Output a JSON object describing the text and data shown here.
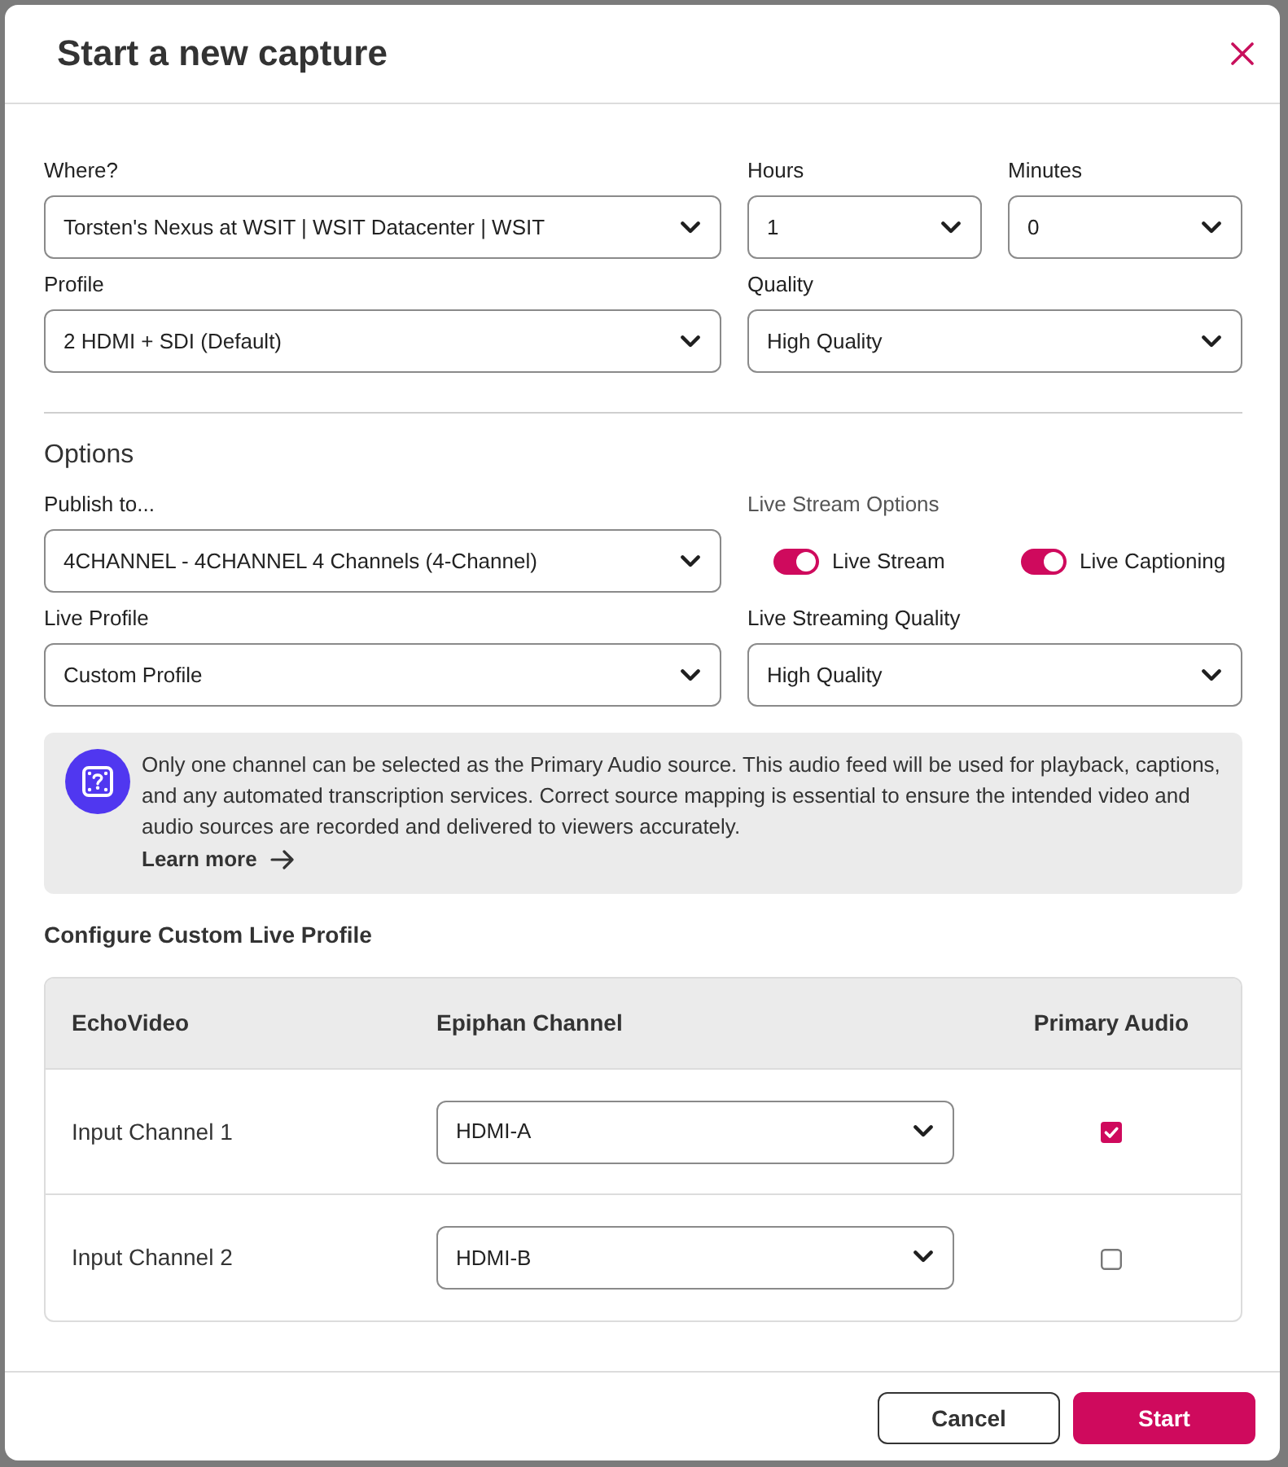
{
  "dialog": {
    "title": "Start a new capture"
  },
  "capture": {
    "where": {
      "label": "Where?",
      "value": "Torsten's Nexus at WSIT | WSIT Datacenter | WSIT"
    },
    "hours": {
      "label": "Hours",
      "value": "1"
    },
    "minutes": {
      "label": "Minutes",
      "value": "0"
    },
    "profile": {
      "label": "Profile",
      "value": "2 HDMI + SDI (Default)"
    },
    "quality": {
      "label": "Quality",
      "value": "High Quality"
    }
  },
  "options": {
    "heading": "Options",
    "publish_to": {
      "label": "Publish to...",
      "value": "4CHANNEL - 4CHANNEL 4 Channels (4-Channel)"
    },
    "live_stream_options": {
      "label": "Live Stream Options",
      "toggles": [
        {
          "label": "Live Stream",
          "on": true
        },
        {
          "label": "Live Captioning",
          "on": true
        }
      ]
    },
    "live_profile": {
      "label": "Live Profile",
      "value": "Custom Profile"
    },
    "live_streaming_quality": {
      "label": "Live Streaming Quality",
      "value": "High Quality"
    }
  },
  "notice": {
    "text": "Only one channel can be selected as the Primary Audio source. This audio feed will be used for playback, captions, and any automated transcription services. Correct source mapping is essential to ensure the intended video and audio sources are recorded and delivered to viewers accurately.",
    "link": "Learn more"
  },
  "custom_live_profile": {
    "heading": "Configure Custom Live Profile",
    "columns": [
      "EchoVideo",
      "Epiphan Channel",
      "Primary Audio"
    ],
    "rows": [
      {
        "input": "Input Channel 1",
        "channel": "HDMI-A",
        "checked": true
      },
      {
        "input": "Input Channel 2",
        "channel": "HDMI-B",
        "checked": false
      }
    ]
  },
  "buttons": [
    {
      "label": "Cancel",
      "kind": "secondary"
    },
    {
      "label": "Start",
      "kind": "primary"
    }
  ]
}
